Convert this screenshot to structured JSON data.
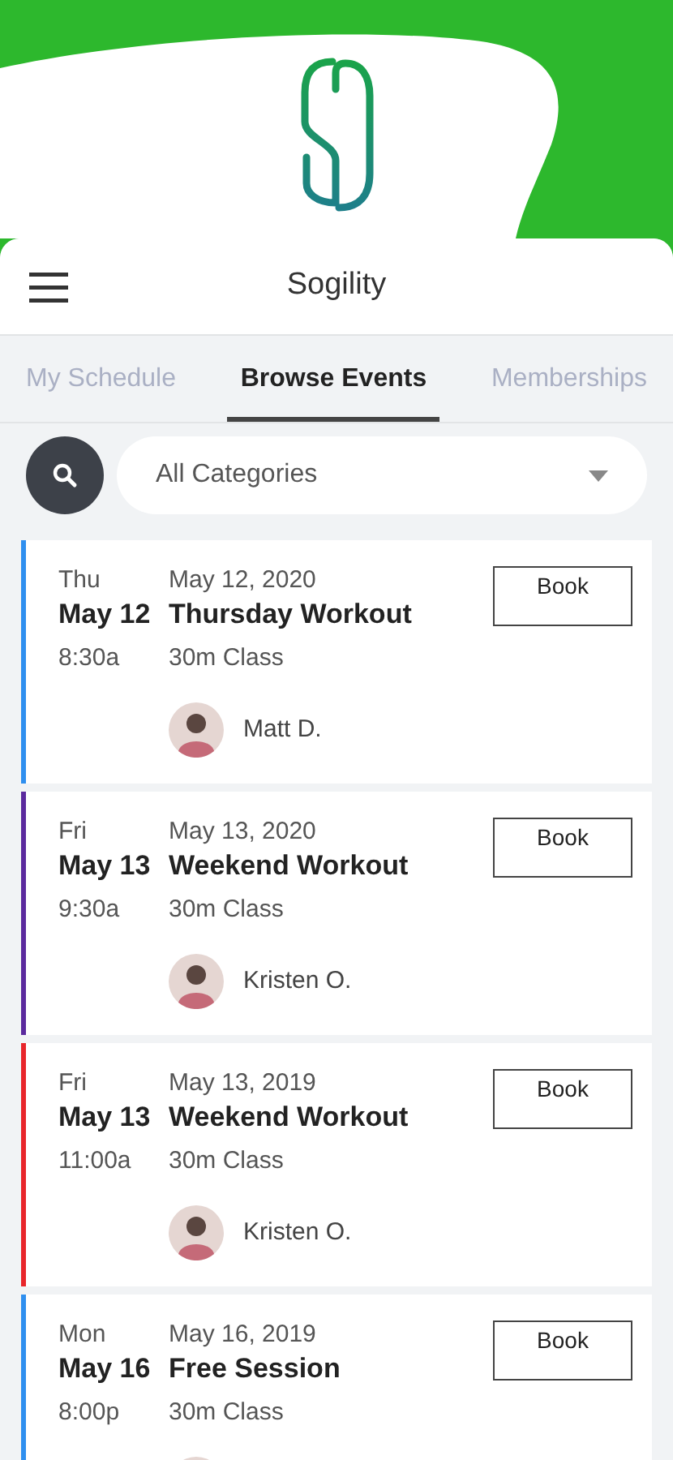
{
  "app": {
    "title": "Sogility"
  },
  "tabs": [
    {
      "label": "My Schedule",
      "selected": false
    },
    {
      "label": "Browse Events",
      "selected": true
    },
    {
      "label": "Memberships",
      "selected": false
    }
  ],
  "filter": {
    "value": "All Categories"
  },
  "events": [
    {
      "weekday": "Thu",
      "date": "May 12",
      "time": "8:30a",
      "full_date": "May 12, 2020",
      "title": "Thursday Workout",
      "type": "30m Class",
      "instructor": "Matt D.",
      "color": "#2f8fef",
      "button": "Book"
    },
    {
      "weekday": "Fri",
      "date": "May 13",
      "time": "9:30a",
      "full_date": "May 13, 2020",
      "title": "Weekend Workout",
      "type": "30m Class",
      "instructor": "Kristen O.",
      "color": "#5b2a9e",
      "button": "Book"
    },
    {
      "weekday": "Fri",
      "date": "May 13",
      "time": "11:00a",
      "full_date": "May 13, 2019",
      "title": "Weekend Workout",
      "type": "30m Class",
      "instructor": "Kristen O.",
      "color": "#e8262b",
      "button": "Book"
    },
    {
      "weekday": "Mon",
      "date": "May 16",
      "time": "8:00p",
      "full_date": "May 16, 2019",
      "title": "Free Session",
      "type": "30m Class",
      "color": "#2f8fef",
      "button": "Book"
    }
  ]
}
